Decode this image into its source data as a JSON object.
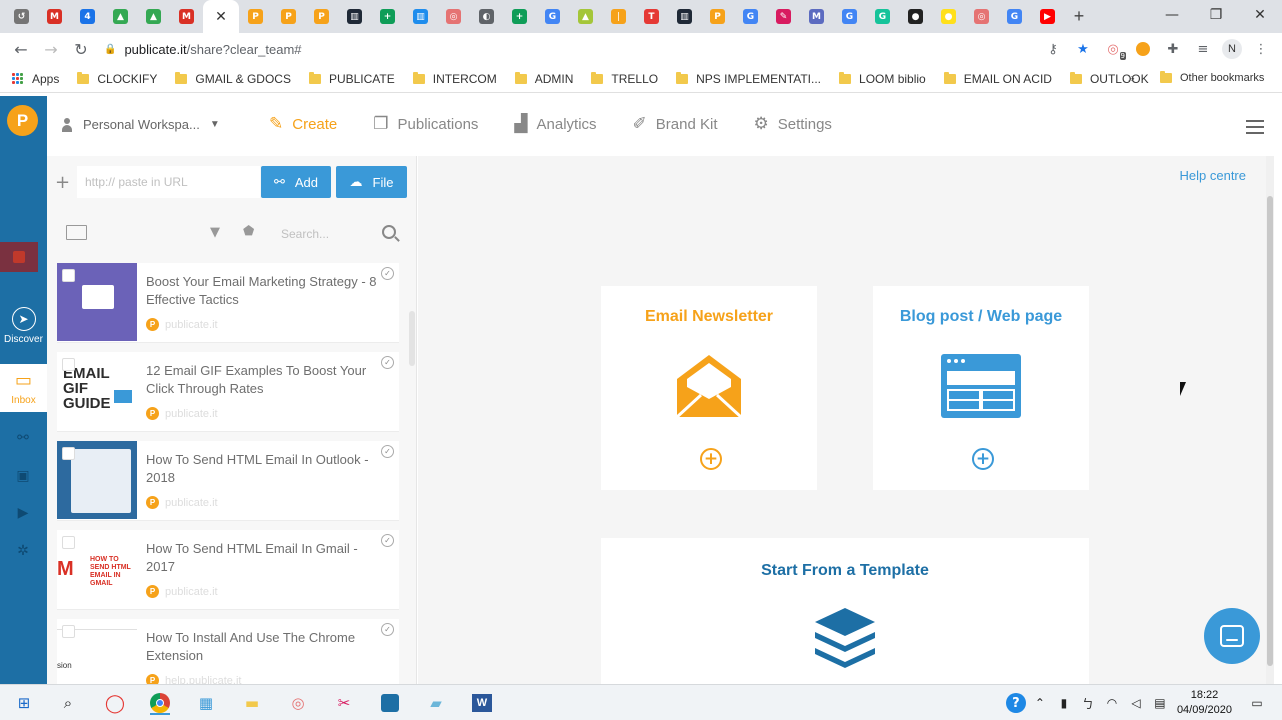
{
  "browser": {
    "tabs": [
      {
        "icon": "back-clock",
        "color": "#757575",
        "glyph": "↺"
      },
      {
        "icon": "gmail",
        "color": "#d93025",
        "glyph": "M"
      },
      {
        "icon": "calendar",
        "color": "#1a73e8",
        "glyph": "4"
      },
      {
        "icon": "drive",
        "color": "#34a853",
        "glyph": "▲"
      },
      {
        "icon": "drive",
        "color": "#34a853",
        "glyph": "▲"
      },
      {
        "icon": "gmail",
        "color": "#d93025",
        "glyph": "M"
      },
      {
        "icon": "close",
        "color": "#ffffff",
        "glyph": "✕",
        "active": true
      },
      {
        "icon": "publicate",
        "color": "#f6a21a",
        "glyph": "P"
      },
      {
        "icon": "publicate",
        "color": "#f6a21a",
        "glyph": "P"
      },
      {
        "icon": "publicate",
        "color": "#f6a21a",
        "glyph": "P"
      },
      {
        "icon": "trello",
        "color": "#1f2937",
        "glyph": "▥"
      },
      {
        "icon": "sheets",
        "color": "#0f9d58",
        "glyph": "+"
      },
      {
        "icon": "intercom",
        "color": "#1f8ded",
        "glyph": "▥"
      },
      {
        "icon": "target",
        "color": "#e57373",
        "glyph": "◎"
      },
      {
        "icon": "globe",
        "color": "#5f6368",
        "glyph": "◐"
      },
      {
        "icon": "sheets",
        "color": "#0f9d58",
        "glyph": "+"
      },
      {
        "icon": "google",
        "color": "#4285f4",
        "glyph": "G"
      },
      {
        "icon": "android",
        "color": "#a4c639",
        "glyph": "▲"
      },
      {
        "icon": "bookmark",
        "color": "#f6a21a",
        "glyph": "❘"
      },
      {
        "icon": "tag",
        "color": "#e53935",
        "glyph": "T"
      },
      {
        "icon": "trello",
        "color": "#1f2937",
        "glyph": "▥"
      },
      {
        "icon": "publicate",
        "color": "#f6a21a",
        "glyph": "P"
      },
      {
        "icon": "google",
        "color": "#4285f4",
        "glyph": "G"
      },
      {
        "icon": "puzzle",
        "color": "#d81b60",
        "glyph": "✎"
      },
      {
        "icon": "mail",
        "color": "#5c6bc0",
        "glyph": "M"
      },
      {
        "icon": "google",
        "color": "#4285f4",
        "glyph": "G"
      },
      {
        "icon": "grammarly",
        "color": "#15c39a",
        "glyph": "G"
      },
      {
        "icon": "github",
        "color": "#222222",
        "glyph": "●"
      },
      {
        "icon": "mailchimp",
        "color": "#ffe01b",
        "glyph": "●"
      },
      {
        "icon": "target",
        "color": "#e57373",
        "glyph": "◎"
      },
      {
        "icon": "google",
        "color": "#4285f4",
        "glyph": "G"
      },
      {
        "icon": "youtube",
        "color": "#ff0000",
        "glyph": "▶"
      }
    ],
    "new_tab": "+",
    "window_controls": [
      "—",
      "❐",
      "✕"
    ],
    "url_host": "publicate.it",
    "url_path": "/share?clear_team#",
    "avatar_letter": "N",
    "extension_badge": "9"
  },
  "bookmarks": {
    "apps_label": "Apps",
    "items": [
      "CLOCKIFY",
      "GMAIL & GDOCS",
      "PUBLICATE",
      "INTERCOM",
      "ADMIN",
      "TRELLO",
      "NPS IMPLEMENTATI...",
      "LOOM biblio",
      "EMAIL ON ACID",
      "OUTLOOK"
    ],
    "more": "»",
    "other": "Other bookmarks"
  },
  "rail": {
    "logo_letter": "P",
    "discover_label": "Discover",
    "inbox_label": "Inbox"
  },
  "appnav": {
    "workspace": "Personal Workspa...",
    "links": [
      {
        "label": "Create",
        "icon": "create-icon",
        "glyph": "✎",
        "active": true
      },
      {
        "label": "Publications",
        "icon": "publications-icon",
        "glyph": "❐"
      },
      {
        "label": "Analytics",
        "icon": "analytics-icon",
        "glyph": "▟"
      },
      {
        "label": "Brand Kit",
        "icon": "brush-icon",
        "glyph": "✐"
      },
      {
        "label": "Settings",
        "icon": "gear-icon",
        "glyph": "⚙"
      }
    ]
  },
  "panel": {
    "url_placeholder": "http:// paste in URL",
    "add_label": "Add",
    "file_label": "File",
    "search_placeholder": "Search...",
    "items": [
      {
        "title": "Boost Your Email Marketing Strategy - 8 Effective Tactics",
        "source": "publicate.it",
        "thumb": "t1"
      },
      {
        "title": "12 Email GIF Examples To Boost Your Click Through Rates",
        "source": "publicate.it",
        "thumb": "t2",
        "thumb_text": "EMAIL GIF GUIDE"
      },
      {
        "title": "How To Send HTML Email In Outlook - 2018",
        "source": "publicate.it",
        "thumb": "t3"
      },
      {
        "title": "How To Send HTML Email In Gmail - 2017",
        "source": "publicate.it",
        "thumb": "t4",
        "thumb_text": "HOW TO SEND HTML EMAIL IN GMAIL"
      },
      {
        "title": "How To Install And Use The Chrome Extension",
        "source": "help.publicate.it",
        "thumb": "t5",
        "thumb_text": "sion"
      }
    ]
  },
  "main": {
    "help_label": "Help centre",
    "tiles": [
      {
        "title": "Email Newsletter",
        "color": "#f6a21a"
      },
      {
        "title": "Blog post / Web page",
        "color": "#3a99d8"
      },
      {
        "title": "Start From a Template",
        "color": "#1d6fa5"
      }
    ]
  },
  "taskbar": {
    "time": "18:22",
    "date": "04/09/2020"
  }
}
